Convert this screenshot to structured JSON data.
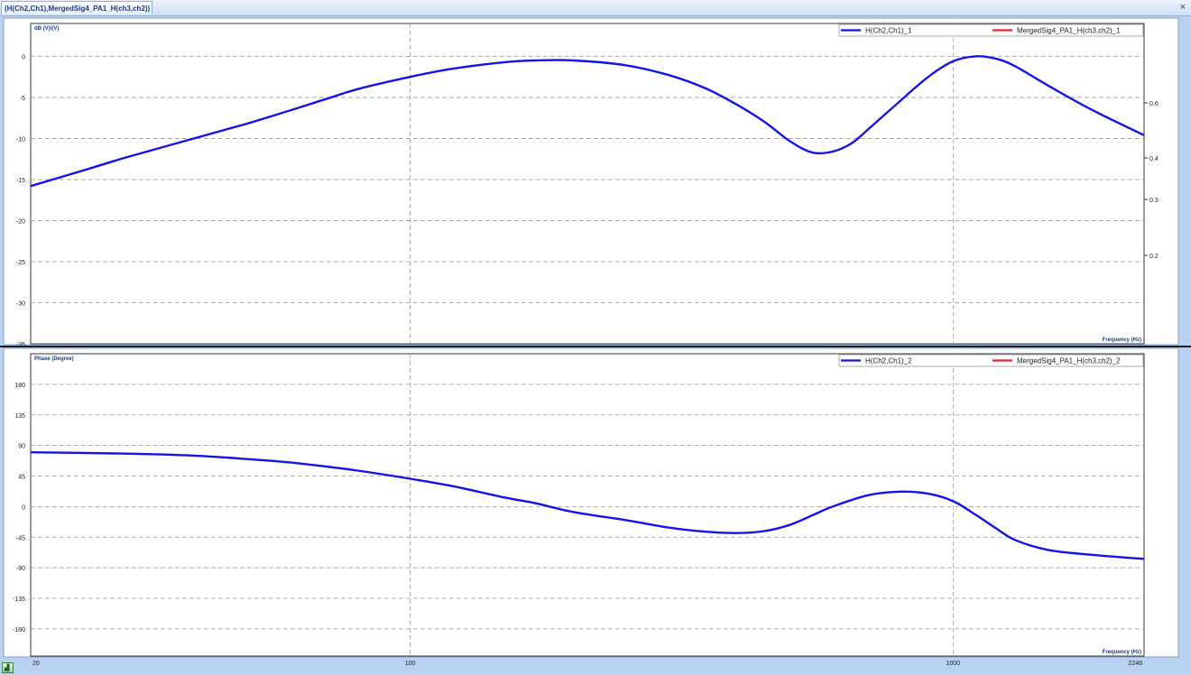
{
  "window": {
    "tab_title": "(H(Ch2,Ch1),MergedSig4_PA1_H(ch3,ch2))",
    "close_glyph": "×"
  },
  "chart_data": [
    {
      "type": "line",
      "xscale": "log",
      "ylabel": "dB (V)/(V)",
      "xlabel": "Frequency (Hz)",
      "ylim": [
        -35,
        4
      ],
      "yticks": [
        0,
        -5,
        -10,
        -15,
        -20,
        -25,
        -30,
        -35
      ],
      "right_axis": {
        "ticks": [
          0.6,
          0.4,
          0.3,
          0.2
        ]
      },
      "grid": true,
      "legend_position": "top-right",
      "series": [
        {
          "name": "H(Ch2,Ch1)_1",
          "color": "#1414e6",
          "x": [
            20,
            25,
            30,
            40,
            50,
            60,
            70,
            80,
            100,
            120,
            150,
            170,
            200,
            250,
            300,
            350,
            400,
            450,
            500,
            550,
            600,
            650,
            700,
            800,
            900,
            1000,
            1100,
            1200,
            1300,
            1500,
            1800,
            2248
          ],
          "y": [
            -15.8,
            -13.9,
            -12.3,
            -10.0,
            -8.2,
            -6.6,
            -5.2,
            -4.0,
            -2.5,
            -1.5,
            -0.7,
            -0.5,
            -0.5,
            -1.1,
            -2.3,
            -3.9,
            -5.9,
            -8.0,
            -10.3,
            -11.7,
            -11.6,
            -10.6,
            -8.8,
            -5.4,
            -2.5,
            -0.6,
            0.0,
            -0.3,
            -1.2,
            -3.6,
            -6.5,
            -9.6
          ]
        },
        {
          "name": "MergedSig4_PA1_H(ch3,ch2)_1",
          "color": "#e8202a"
        }
      ]
    },
    {
      "type": "line",
      "xscale": "log",
      "ylabel": "Phase (Degree)",
      "xlabel": "Frequency (Hz)",
      "ylim": [
        -220,
        225
      ],
      "yticks": [
        180,
        135,
        90,
        45,
        0,
        -45,
        -90,
        -135,
        -180
      ],
      "xticks": [
        20,
        100,
        1000,
        2248
      ],
      "grid": true,
      "legend_position": "top-right",
      "series": [
        {
          "name": "H(Ch2,Ch1)_2",
          "color": "#1414e6",
          "x": [
            20,
            30,
            40,
            50,
            60,
            70,
            80,
            100,
            120,
            150,
            170,
            200,
            250,
            300,
            350,
            400,
            450,
            500,
            550,
            600,
            700,
            800,
            900,
            1000,
            1100,
            1200,
            1300,
            1500,
            1800,
            2248
          ],
          "y": [
            80,
            78,
            75,
            70,
            65,
            59,
            53,
            41,
            30,
            13,
            5,
            -8,
            -20,
            -31,
            -37,
            -39,
            -36,
            -27,
            -13,
            0,
            17,
            22,
            19,
            8,
            -12,
            -32,
            -49,
            -64,
            -71,
            -77
          ]
        },
        {
          "name": "MergedSig4_PA1_H(ch3,ch2)_2",
          "color": "#e8202a"
        }
      ]
    }
  ]
}
